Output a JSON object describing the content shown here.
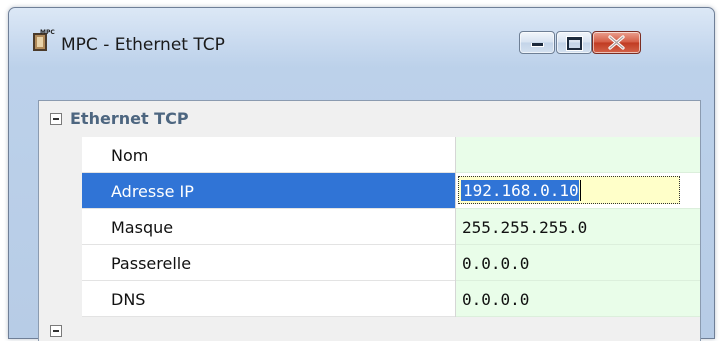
{
  "window": {
    "title": "MPC - Ethernet TCP",
    "icon": "mpc-app-icon",
    "controls": {
      "minimize": "minimize-icon",
      "maximize": "maximize-icon",
      "close": "close-icon"
    }
  },
  "property_grid": {
    "category": {
      "label": "Ethernet TCP",
      "expander": "collapse-minus-icon",
      "expanded": true
    },
    "rows": [
      {
        "name": "Nom",
        "value": ""
      },
      {
        "name": "Adresse IP",
        "value": "192.168.0.10",
        "selected": true,
        "editing": true
      },
      {
        "name": "Masque",
        "value": "255.255.255.0"
      },
      {
        "name": "Passerelle",
        "value": "0.0.0.0"
      },
      {
        "name": "DNS",
        "value": "0.0.0.0"
      }
    ]
  },
  "colors": {
    "selection": "#3074d6",
    "value_bg": "#e9fde9",
    "edit_bg": "#ffffc9",
    "category_text": "#4d6680"
  }
}
